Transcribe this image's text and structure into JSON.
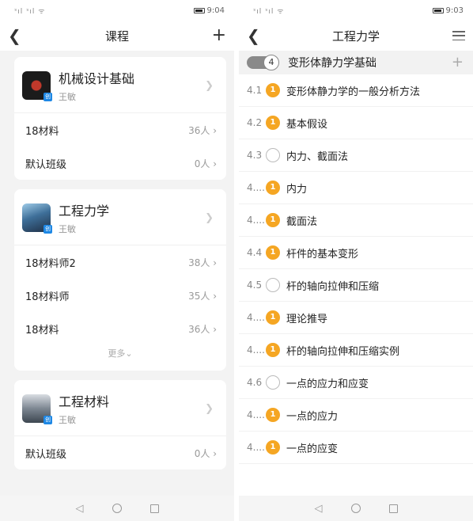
{
  "left": {
    "status": {
      "signal": "ᴺᴵˡˡ ᴺᴵˡˡ ⨹",
      "time": "9:04"
    },
    "title": "课程",
    "add_icon": "plus-icon",
    "courses": [
      {
        "name": "机械设计基础",
        "teacher": "王敏",
        "classes": [
          {
            "name": "18材料",
            "count": "36人"
          },
          {
            "name": "默认班级",
            "count": "0人"
          }
        ],
        "more": ""
      },
      {
        "name": "工程力学",
        "teacher": "王敏",
        "classes": [
          {
            "name": "18材料师2",
            "count": "38人"
          },
          {
            "name": "18材料师",
            "count": "35人"
          },
          {
            "name": "18材料",
            "count": "36人"
          }
        ],
        "more": "更多"
      },
      {
        "name": "工程材料",
        "teacher": "王敏",
        "classes": [
          {
            "name": "默认班级",
            "count": "0人"
          }
        ],
        "more": ""
      }
    ],
    "thumb_tag": "创"
  },
  "right": {
    "status": {
      "time": "9:03"
    },
    "title": "工程力学",
    "chapter": {
      "number": "4",
      "title": "变形体静力学基础"
    },
    "sections": [
      {
        "num": "4.1",
        "title": "变形体静力学的一般分析方法",
        "state": "done"
      },
      {
        "num": "4.2",
        "title": "基本假设",
        "state": "done"
      },
      {
        "num": "4.3",
        "title": " 内力、截面法",
        "state": "empty"
      },
      {
        "num": "4....",
        "title": "内力",
        "state": "done"
      },
      {
        "num": "4....",
        "title": "截面法",
        "state": "done"
      },
      {
        "num": "4.4",
        "title": " 杆件的基本变形",
        "state": "done"
      },
      {
        "num": "4.5",
        "title": "杆的轴向拉伸和压缩",
        "state": "empty"
      },
      {
        "num": "4....",
        "title": "理论推导",
        "state": "done"
      },
      {
        "num": "4....",
        "title": "杆的轴向拉伸和压缩实例",
        "state": "done"
      },
      {
        "num": "4.6",
        "title": " 一点的应力和应变",
        "state": "empty"
      },
      {
        "num": "4....",
        "title": "一点的应力",
        "state": "done"
      },
      {
        "num": "4....",
        "title": "一点的应变",
        "state": "done"
      }
    ]
  },
  "colors": {
    "accent": "#f5a623",
    "tag_blue": "#1e88e5"
  }
}
